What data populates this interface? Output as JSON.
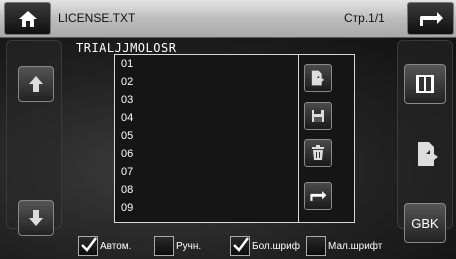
{
  "header": {
    "title": "LICENSE.TXT",
    "page_indicator": "Стр.1/1"
  },
  "content": {
    "heading_text": "TRIALJJMOLOSR",
    "items": [
      "01",
      "02",
      "03",
      "04",
      "05",
      "06",
      "07",
      "08",
      "09"
    ]
  },
  "side": {
    "gbk_label": "GBK"
  },
  "options": [
    {
      "label": "Автом.",
      "checked": true
    },
    {
      "label": "Ручн.",
      "checked": false
    },
    {
      "label": "Бол.шриф",
      "checked": true
    },
    {
      "label": "Мал.шрифт",
      "checked": false
    }
  ],
  "icons": {
    "home": "home-icon",
    "back": "back-arrow-icon",
    "up": "arrow-up-icon",
    "down": "arrow-down-icon",
    "open_book": "book-icon",
    "share_doc": "document-share-icon",
    "save": "floppy-disk-icon",
    "delete": "trash-icon",
    "return": "return-arrow-icon"
  },
  "colors": {
    "header_bg": "#c8c8c8",
    "body_bg": "#181818",
    "text": "#ffffff"
  }
}
